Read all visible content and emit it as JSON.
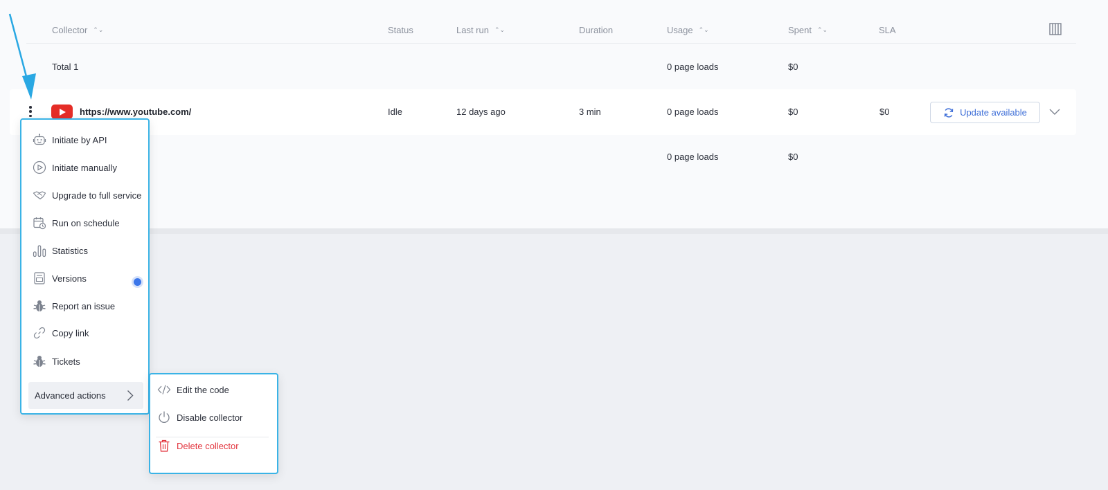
{
  "table": {
    "headers": {
      "collector": "Collector",
      "status": "Status",
      "last_run": "Last run",
      "duration": "Duration",
      "usage": "Usage",
      "spent": "Spent",
      "sla": "SLA"
    },
    "sort_glyph": "⌃⌄",
    "total_row": {
      "label": "Total 1",
      "usage": "0 page loads",
      "spent": "$0"
    },
    "row": {
      "url": "https://www.youtube.com/",
      "status": "Idle",
      "last_run": "12 days ago",
      "duration": "3 min",
      "usage": "0 page loads",
      "spent": "$0",
      "sla": "$0",
      "update_label": "Update available"
    },
    "summary_row": {
      "usage": "0 page loads",
      "spent": "$0"
    }
  },
  "menu": {
    "items": [
      {
        "label": "Initiate by API",
        "icon": "robot-icon"
      },
      {
        "label": "Initiate manually",
        "icon": "play-circle-icon"
      },
      {
        "label": "Upgrade to full service",
        "icon": "handshake-icon"
      },
      {
        "label": "Run on schedule",
        "icon": "calendar-clock-icon"
      },
      {
        "label": "Statistics",
        "icon": "bar-chart-icon"
      },
      {
        "label": "Versions",
        "icon": "file-version-icon"
      },
      {
        "label": "Report an issue",
        "icon": "bug-icon"
      },
      {
        "label": "Copy link",
        "icon": "link-icon"
      },
      {
        "label": "Tickets",
        "icon": "bug-icon"
      }
    ],
    "advanced_label": "Advanced actions"
  },
  "submenu": {
    "items": [
      {
        "label": "Edit the code",
        "icon": "code-icon"
      },
      {
        "label": "Disable collector",
        "icon": "power-icon"
      },
      {
        "label": "Delete collector",
        "icon": "trash-icon"
      }
    ]
  },
  "colors": {
    "accent": "#3f6fd8",
    "highlight_border": "#3ab3e6",
    "danger": "#e2333c",
    "youtube_red": "#e52d27",
    "versions_dot": "#3b76ea"
  }
}
